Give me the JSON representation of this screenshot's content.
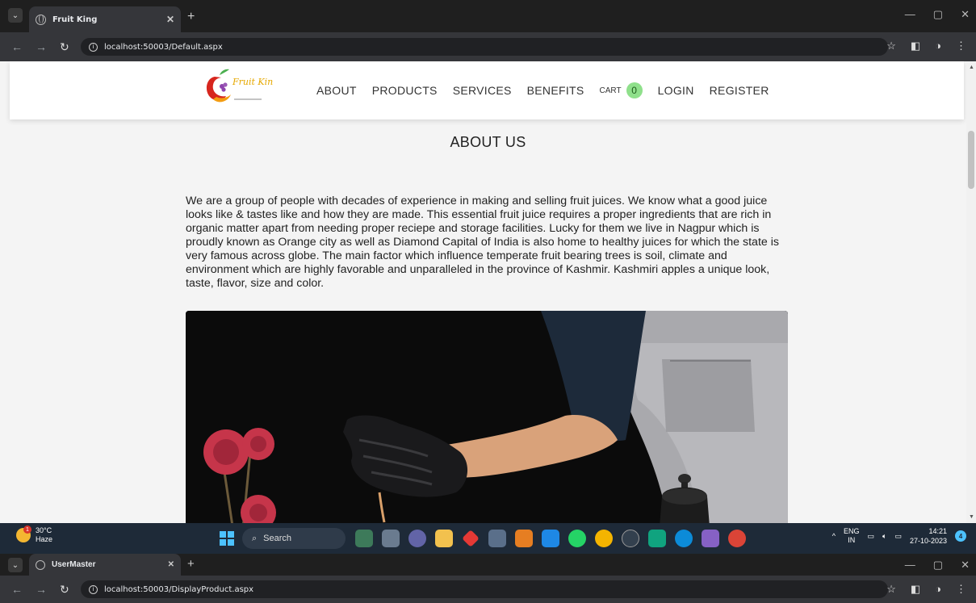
{
  "browser_top": {
    "tab_title": "Fruit King",
    "url": "localhost:50003/Default.aspx"
  },
  "site": {
    "logo_text": "Fruit King",
    "nav": {
      "about": "ABOUT",
      "products": "PRODUCTS",
      "services": "SERVICES",
      "benefits": "BENEFITS",
      "cart": "CART",
      "cart_count": "0",
      "login": "LOGIN",
      "register": "REGISTER"
    },
    "about_title": "ABOUT US",
    "about_text": "We are a group of people with decades of experience in making and selling fruit juices. We know what a good juice looks like & tastes like and how they are made. This essential fruit juice requires a proper ingredients that are rich in organic matter apart from needing proper reciepe and storage facilities. Lucky for them we live in Nagpur which is proudly known as Orange city as well as Diamond Capital of India is also home to healthy juices for which the state is very famous across globe. The main factor which influence temperate fruit bearing trees is soil, climate and environment which are highly favorable and unparalleled in the province of Kashmir. Kashmiri apples a unique look, taste, flavor, size and color."
  },
  "taskbar": {
    "weather_temp": "30°C",
    "weather_desc": "Haze",
    "weather_badge": "1",
    "search_label": "Search",
    "lang_top": "ENG",
    "lang_bottom": "IN",
    "time": "14:21",
    "date": "27-10-2023",
    "notif_count": "4"
  },
  "browser_bottom": {
    "tab_title": "UserMaster",
    "url": "localhost:50003/DisplayProduct.aspx"
  },
  "colors": {
    "cart_badge": "#8fe08b",
    "page_bg": "#f4f4f4",
    "chrome_dark": "#35363a",
    "taskbar": "#1e2a38"
  }
}
